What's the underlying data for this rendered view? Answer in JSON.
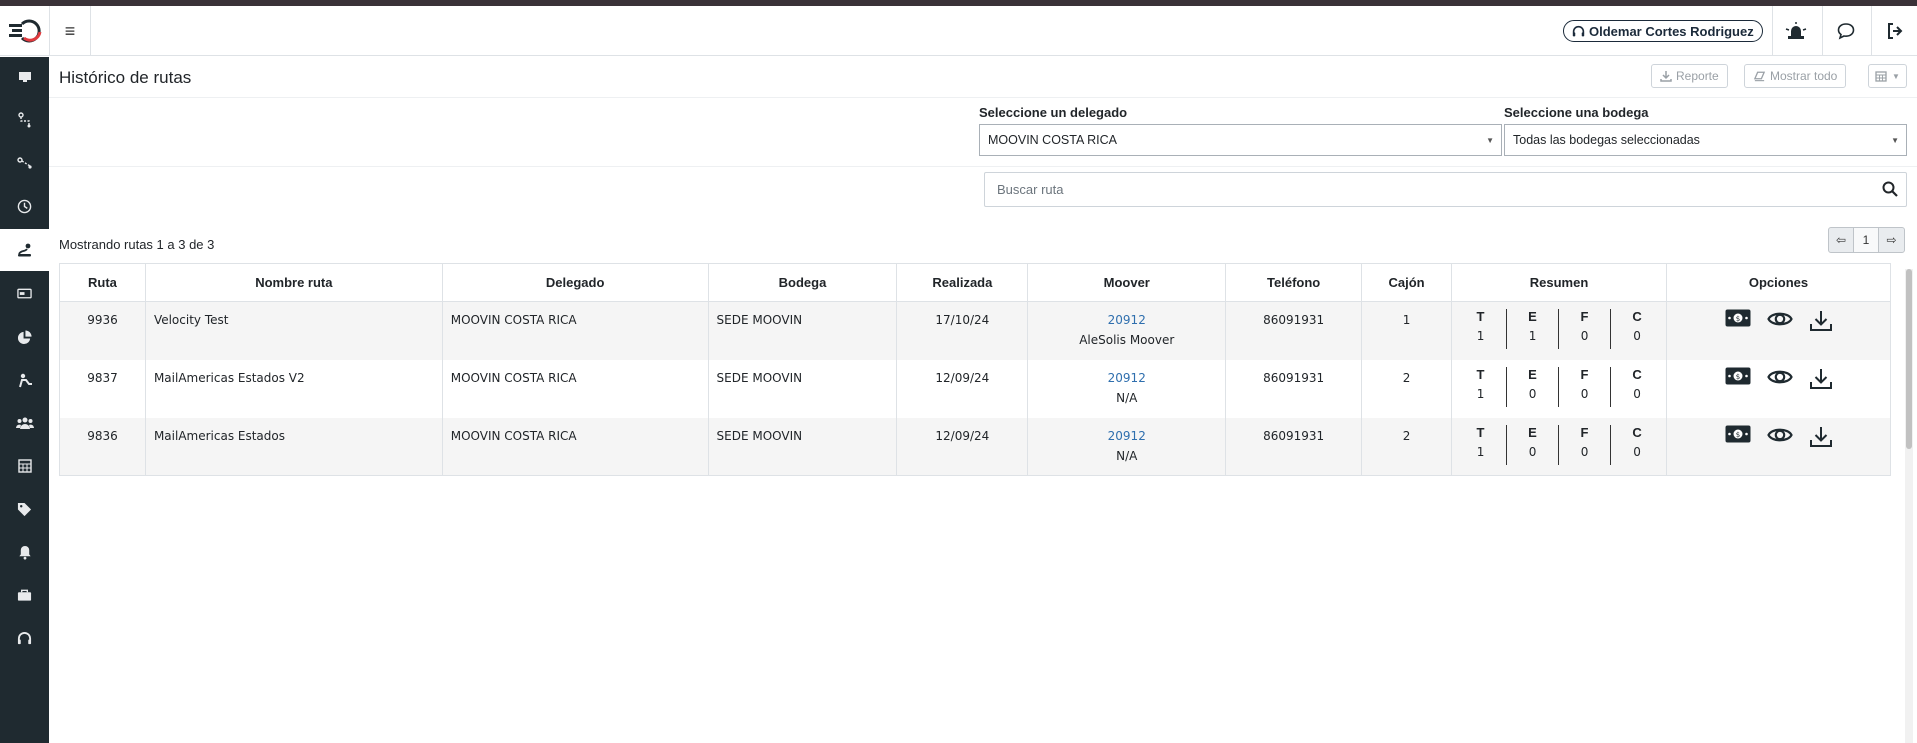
{
  "header": {
    "user_name": "Oldemar Cortes Rodriguez"
  },
  "sidebar": {
    "items": [
      {
        "icon": "monitor-icon"
      },
      {
        "icon": "route-icon"
      },
      {
        "icon": "route-alt-icon"
      },
      {
        "icon": "clock-icon"
      },
      {
        "icon": "route-history-icon",
        "active": true
      },
      {
        "icon": "money-check-icon"
      },
      {
        "icon": "pie-chart-icon"
      },
      {
        "icon": "dolly-icon"
      },
      {
        "icon": "users-icon"
      },
      {
        "icon": "table-icon"
      },
      {
        "icon": "tag-icon"
      },
      {
        "icon": "bell-icon"
      },
      {
        "icon": "briefcase-icon"
      },
      {
        "icon": "headset-icon"
      }
    ]
  },
  "page": {
    "title": "Histórico de rutas",
    "report_label": "Reporte",
    "show_all_label": "Mostrar todo"
  },
  "filters": {
    "delegate_label": "Seleccione un delegado",
    "delegate_value": "MOOVIN COSTA RICA",
    "warehouse_label": "Seleccione una bodega",
    "warehouse_value": "Todas las bodegas seleccionadas"
  },
  "search": {
    "placeholder": "Buscar ruta"
  },
  "listing": {
    "count_text": "Mostrando rutas 1 a 3 de 3",
    "pager_prev": "⇦",
    "pager_page": "1",
    "pager_next": "⇨"
  },
  "table": {
    "headers": [
      "Ruta",
      "Nombre ruta",
      "Delegado",
      "Bodega",
      "Realizada",
      "Moover",
      "Teléfono",
      "Cajón",
      "Resumen",
      "Opciones"
    ],
    "resumen_keys": [
      "T",
      "E",
      "F",
      "C"
    ],
    "rows": [
      {
        "ruta": "9936",
        "nombre": "Velocity Test",
        "delegado": "MOOVIN COSTA RICA",
        "bodega": "SEDE MOOVIN",
        "realizada": "17/10/24",
        "moover_id": "20912",
        "moover_name": "AleSolis Moover",
        "telefono": "86091931",
        "cajon": "1",
        "resumen": [
          "1",
          "1",
          "0",
          "0"
        ]
      },
      {
        "ruta": "9837",
        "nombre": "MailAmericas Estados V2",
        "delegado": "MOOVIN COSTA RICA",
        "bodega": "SEDE MOOVIN",
        "realizada": "12/09/24",
        "moover_id": "20912",
        "moover_name": "N/A",
        "telefono": "86091931",
        "cajon": "2",
        "resumen": [
          "1",
          "0",
          "0",
          "0"
        ]
      },
      {
        "ruta": "9836",
        "nombre": "MailAmericas Estados",
        "delegado": "MOOVIN COSTA RICA",
        "bodega": "SEDE MOOVIN",
        "realizada": "12/09/24",
        "moover_id": "20912",
        "moover_name": "N/A",
        "telefono": "86091931",
        "cajon": "2",
        "resumen": [
          "1",
          "0",
          "0",
          "0"
        ]
      }
    ]
  }
}
